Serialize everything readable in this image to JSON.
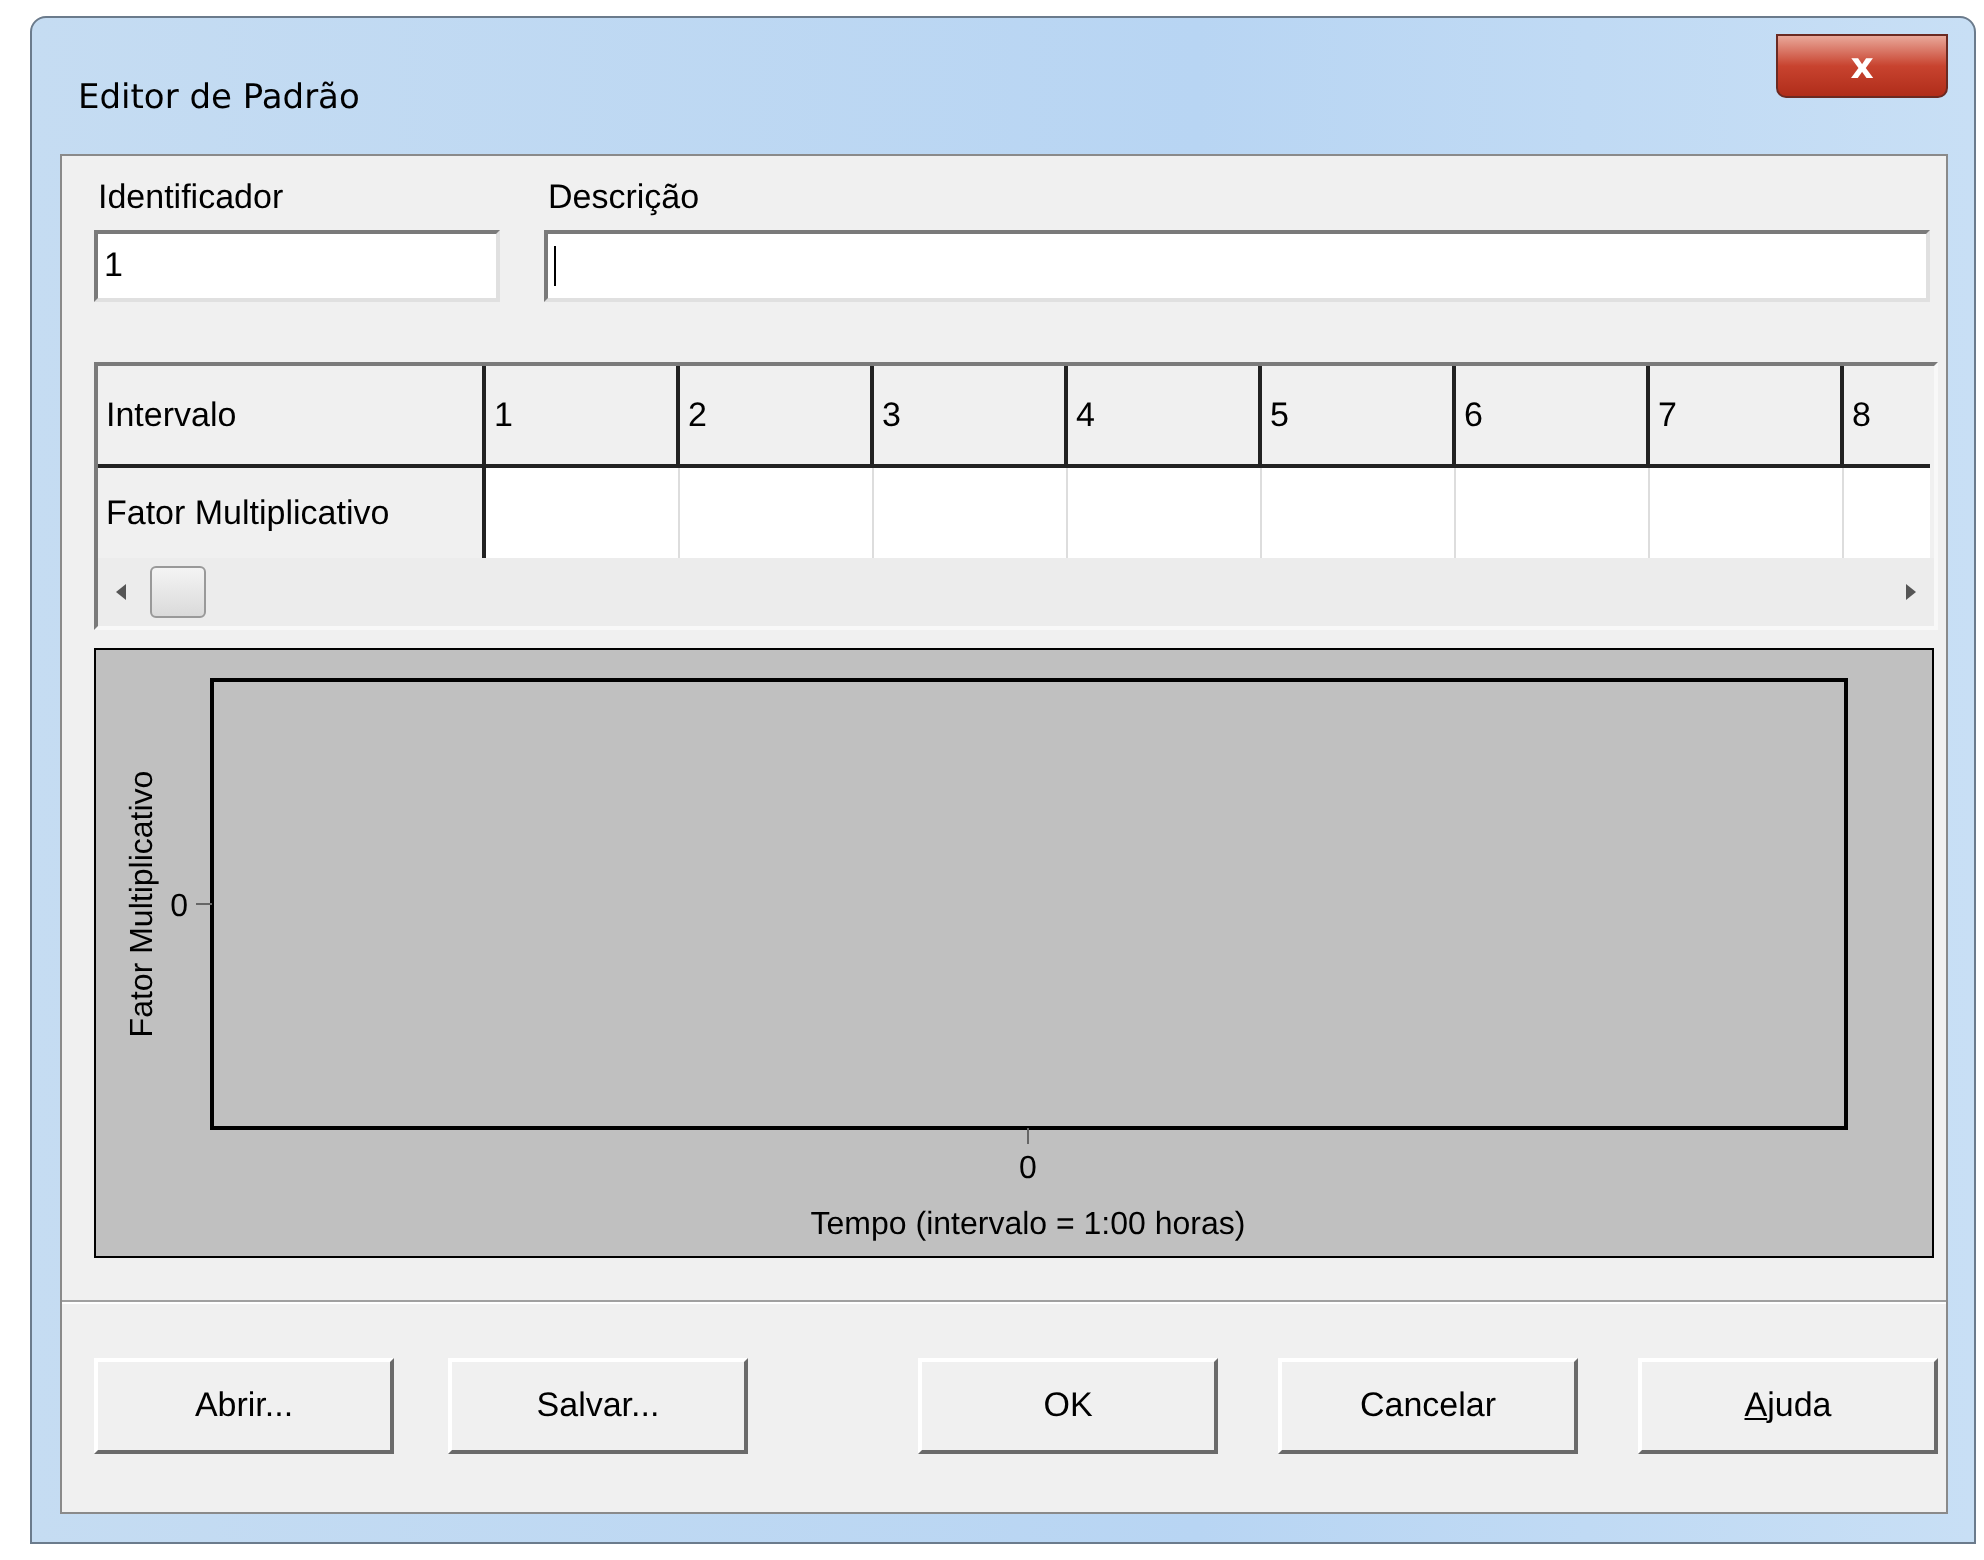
{
  "window": {
    "title": "Editor de Padrão",
    "close": "x"
  },
  "fields": [
    {
      "label": "Identificador",
      "value": "1",
      "focused": false
    },
    {
      "label": "Descrição",
      "focused": true
    }
  ],
  "grid": {
    "row_headers": [
      "Intervalo",
      "Fator Multiplicativo"
    ],
    "columns": [
      "1",
      "2",
      "3",
      "4",
      "5",
      "6",
      "7",
      "8"
    ]
  },
  "plot": {
    "ylabel": "Fator Multiplicativo",
    "ytick": "0",
    "xtick": "0",
    "xlabel": "Tempo (intervalo = 1:00  horas)"
  },
  "buttons": [
    {
      "label": "Abrir...",
      "underline_first": false
    },
    {
      "label": "Salvar...",
      "underline_first": false
    },
    {
      "label": "OK",
      "underline_first": false
    },
    {
      "label": "Cancelar",
      "underline_first": false
    },
    {
      "label": "Ajuda",
      "underline_first": true
    }
  ]
}
